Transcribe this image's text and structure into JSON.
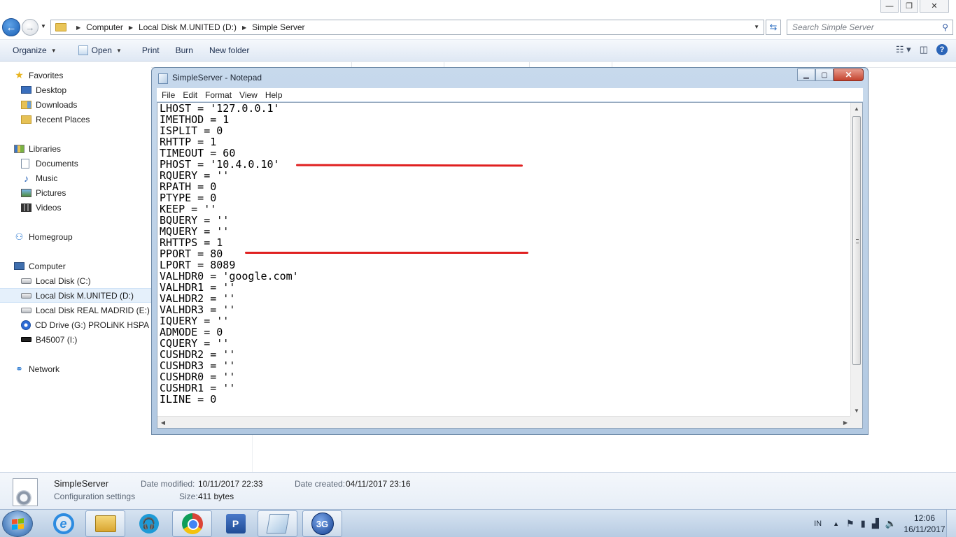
{
  "explorer": {
    "window_controls": {
      "minimize": "—",
      "maximize": "❐",
      "close": "✕"
    },
    "breadcrumb": [
      "Computer",
      "Local Disk M.UNITED (D:)",
      "Simple Server"
    ],
    "search_placeholder": "Search Simple Server",
    "toolbar": {
      "organize": "Organize",
      "open": "Open",
      "print": "Print",
      "burn": "Burn",
      "new_folder": "New folder"
    },
    "nav": {
      "favorites": {
        "label": "Favorites",
        "items": [
          "Desktop",
          "Downloads",
          "Recent Places"
        ]
      },
      "libraries": {
        "label": "Libraries",
        "items": [
          "Documents",
          "Music",
          "Pictures",
          "Videos"
        ]
      },
      "homegroup": "Homegroup",
      "computer": {
        "label": "Computer",
        "items": [
          "Local Disk (C:)",
          "Local Disk M.UNITED (D:)",
          "Local Disk REAL MADRID (E:)",
          "CD Drive (G:) PROLiNK HSPA",
          "B45007 (I:)"
        ],
        "selected_index": 1
      },
      "network": "Network"
    },
    "details": {
      "name": "SimpleServer",
      "type": "Configuration settings",
      "date_modified_label": "Date modified:",
      "date_modified": "10/11/2017 22:33",
      "date_created_label": "Date created:",
      "date_created": "04/11/2017 23:16",
      "size_label": "Size:",
      "size": "411 bytes"
    }
  },
  "notepad": {
    "title": "SimpleServer - Notepad",
    "menu": [
      "File",
      "Edit",
      "Format",
      "View",
      "Help"
    ],
    "lines": [
      "LHOST = '127.0.0.1'",
      "IMETHOD = 1",
      "ISPLIT = 0",
      "RHTTP = 1",
      "TIMEOUT = 60",
      "PHOST = '10.4.0.10'",
      "RQUERY = ''",
      "RPATH = 0",
      "PTYPE = 0",
      "KEEP = ''",
      "BQUERY = ''",
      "MQUERY = ''",
      "RHTTPS = 1",
      "PPORT = 80",
      "LPORT = 8089",
      "VALHDR0 = 'google.com'",
      "VALHDR1 = ''",
      "VALHDR2 = ''",
      "VALHDR3 = ''",
      "IQUERY = ''",
      "ADMODE = 0",
      "CQUERY = ''",
      "CUSHDR2 = ''",
      "CUSHDR3 = ''",
      "CUSHDR0 = ''",
      "CUSHDR1 = ''",
      "ILINE = 0"
    ]
  },
  "taskbar": {
    "tray_lang": "IN",
    "time": "12:06",
    "date": "16/11/2017",
    "app_3g_label": "3G"
  },
  "colors": {
    "highlight_red": "#e02020",
    "toolbar_gradient_top": "#f5f8fc",
    "selection_blue": "#e5f0fb"
  }
}
